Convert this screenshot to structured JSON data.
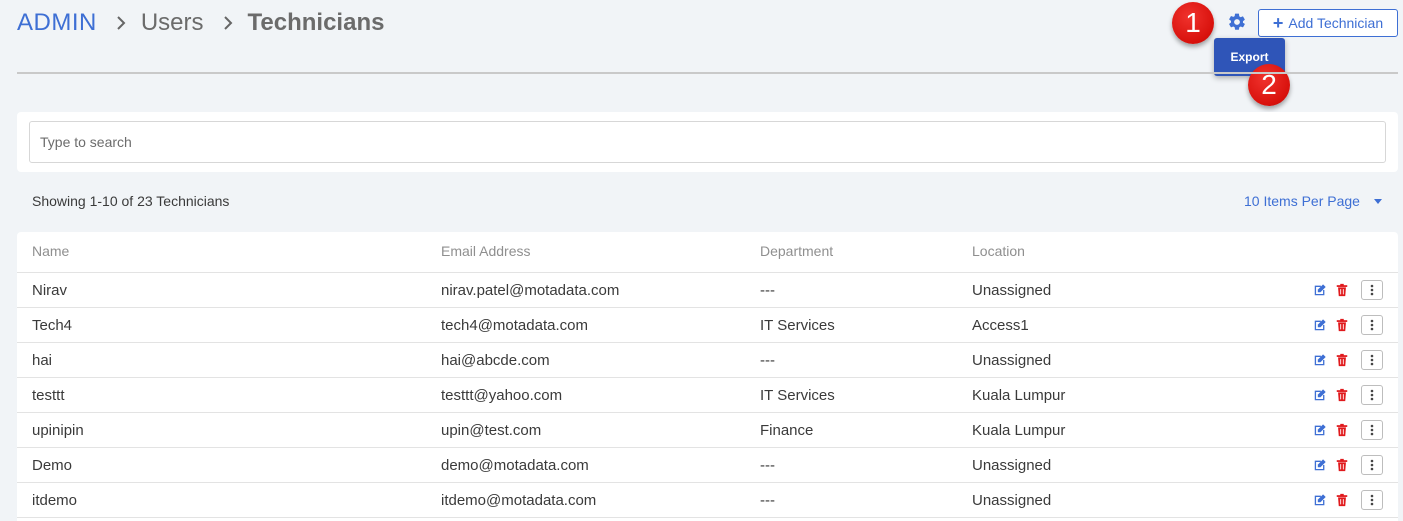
{
  "breadcrumb": {
    "root": "ADMIN",
    "users": "Users",
    "current": "Technicians"
  },
  "toolbar": {
    "add_label": "Add Technician",
    "settings_icon": "gear-icon",
    "export_label": "Export"
  },
  "markers": {
    "one": "1",
    "two": "2"
  },
  "search": {
    "placeholder": "Type to search",
    "value": ""
  },
  "summary": {
    "showing": "Showing 1-10 of 23 Technicians",
    "per_page": "10 Items Per Page"
  },
  "table": {
    "columns": {
      "name": "Name",
      "email": "Email Address",
      "department": "Department",
      "location": "Location"
    },
    "rows": [
      {
        "name": "Nirav",
        "email": "nirav.patel@motadata.com",
        "department": "---",
        "location": "Unassigned"
      },
      {
        "name": "Tech4",
        "email": "tech4@motadata.com",
        "department": "IT Services",
        "location": "Access1"
      },
      {
        "name": "hai",
        "email": "hai@abcde.com",
        "department": "---",
        "location": "Unassigned"
      },
      {
        "name": "testtt",
        "email": "testtt@yahoo.com",
        "department": "IT Services",
        "location": "Kuala Lumpur"
      },
      {
        "name": "upinipin",
        "email": "upin@test.com",
        "department": "Finance",
        "location": "Kuala Lumpur"
      },
      {
        "name": "Demo",
        "email": "demo@motadata.com",
        "department": "---",
        "location": "Unassigned"
      },
      {
        "name": "itdemo",
        "email": "itdemo@motadata.com",
        "department": "---",
        "location": "Unassigned"
      }
    ]
  },
  "colors": {
    "accent": "#3e6fd4",
    "danger": "#e0191c",
    "export_bg": "#2f55b8",
    "marker": "#e01a16",
    "page_bg": "#f1f4f7"
  }
}
